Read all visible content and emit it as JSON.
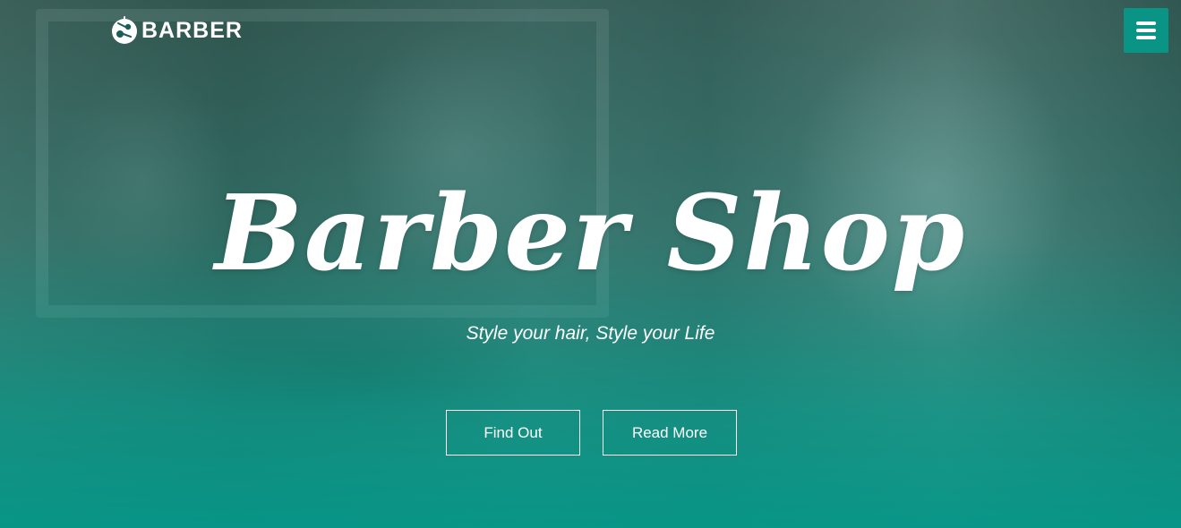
{
  "brand": {
    "logo_icon": "barber-scissors-logo-icon",
    "name": "BARBER"
  },
  "nav": {
    "menu_icon": "hamburger-menu-icon"
  },
  "hero": {
    "title": "Barber Shop",
    "subtitle": "Style your hair, Style your Life",
    "buttons": [
      {
        "label": "Find Out"
      },
      {
        "label": "Read More"
      }
    ]
  },
  "colors": {
    "accent": "#0a9486",
    "text": "#ffffff",
    "overlay_top": "#14463f",
    "overlay_bottom": "#059687"
  }
}
